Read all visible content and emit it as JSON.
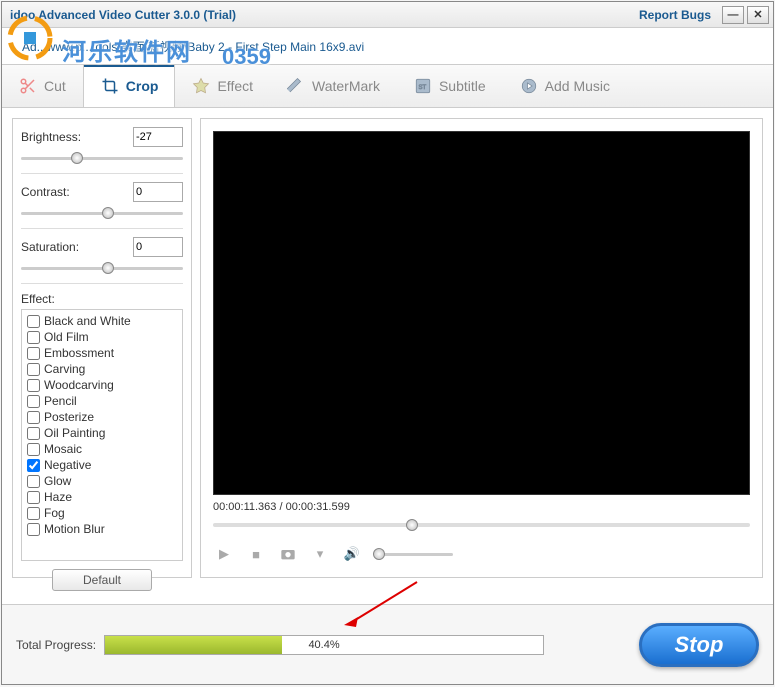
{
  "titlebar": {
    "title": "idoo Advanced Video Cutter 3.0.0 (Trial)",
    "report": "Report Bugs"
  },
  "watermark": {
    "text": "河乐软件网",
    "sub": "www.pc...cools",
    "num": "0359"
  },
  "filepath": "Ad...www.p...tools 桌面\\新视频\\Baby 2 - First Step Main 16x9.avi",
  "tabs": {
    "cut": "Cut",
    "crop": "Crop",
    "effect": "Effect",
    "watermark": "WaterMark",
    "subtitle": "Subtitle",
    "addmusic": "Add Music"
  },
  "sliders": {
    "brightness": {
      "label": "Brightness:",
      "value": "-27",
      "pos": 31
    },
    "contrast": {
      "label": "Contrast:",
      "value": "0",
      "pos": 50
    },
    "saturation": {
      "label": "Saturation:",
      "value": "0",
      "pos": 50
    }
  },
  "effect_label": "Effect:",
  "effects": [
    {
      "label": "Black and White",
      "checked": false
    },
    {
      "label": "Old Film",
      "checked": false
    },
    {
      "label": "Embossment",
      "checked": false
    },
    {
      "label": "Carving",
      "checked": false
    },
    {
      "label": "Woodcarving",
      "checked": false
    },
    {
      "label": "Pencil",
      "checked": false
    },
    {
      "label": "Posterize",
      "checked": false
    },
    {
      "label": "Oil Painting",
      "checked": false
    },
    {
      "label": "Mosaic",
      "checked": false
    },
    {
      "label": "Negative",
      "checked": true
    },
    {
      "label": "Glow",
      "checked": false
    },
    {
      "label": "Haze",
      "checked": false
    },
    {
      "label": "Fog",
      "checked": false
    },
    {
      "label": "Motion Blur",
      "checked": false
    }
  ],
  "default_btn": "Default",
  "time": "00:00:11.363 / 00:00:31.599",
  "progress": {
    "label": "Total Progress:",
    "percent": 40.4,
    "text": "40.4%"
  },
  "stop_btn": "Stop"
}
